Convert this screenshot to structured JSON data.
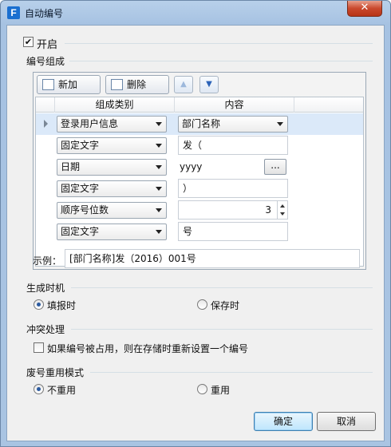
{
  "window": {
    "title": "自动编号",
    "app_icon": "F",
    "close_glyph": "✕"
  },
  "enable": {
    "label": "开启",
    "checked": true
  },
  "composition": {
    "label": "编号组成",
    "add_label": "新加",
    "delete_label": "删除",
    "up_glyph": "▲",
    "down_glyph": "▼",
    "columns": [
      "组成类别",
      "内容"
    ],
    "rows": [
      {
        "type": "登录用户信息",
        "content": "部门名称",
        "content_kind": "combo",
        "selected": true
      },
      {
        "type": "固定文字",
        "content": "发（",
        "content_kind": "text"
      },
      {
        "type": "日期",
        "content": "yyyy",
        "content_kind": "picker",
        "button": "..."
      },
      {
        "type": "固定文字",
        "content": "）",
        "content_kind": "text"
      },
      {
        "type": "顺序号位数",
        "content": "3",
        "content_kind": "spinner"
      },
      {
        "type": "固定文字",
        "content": "号",
        "content_kind": "text"
      }
    ]
  },
  "example": {
    "label": "示例：",
    "value": "[部门名称]发（2016）001号"
  },
  "generate_timing": {
    "label": "生成时机",
    "options": [
      "填报时",
      "保存时"
    ],
    "selected": "填报时"
  },
  "conflict": {
    "label": "冲突处理",
    "checkbox_label": "如果编号被占用，则在存储时重新设置一个编号",
    "checked": false
  },
  "reuse_mode": {
    "label": "废号重用模式",
    "options": [
      "不重用",
      "重用"
    ],
    "selected": "不重用"
  },
  "buttons": {
    "ok": "确定",
    "cancel": "取消"
  },
  "colors": {
    "selected_row": "#dbe9f9",
    "close_button": "#c9492d",
    "default_button": "#bee6fd"
  }
}
